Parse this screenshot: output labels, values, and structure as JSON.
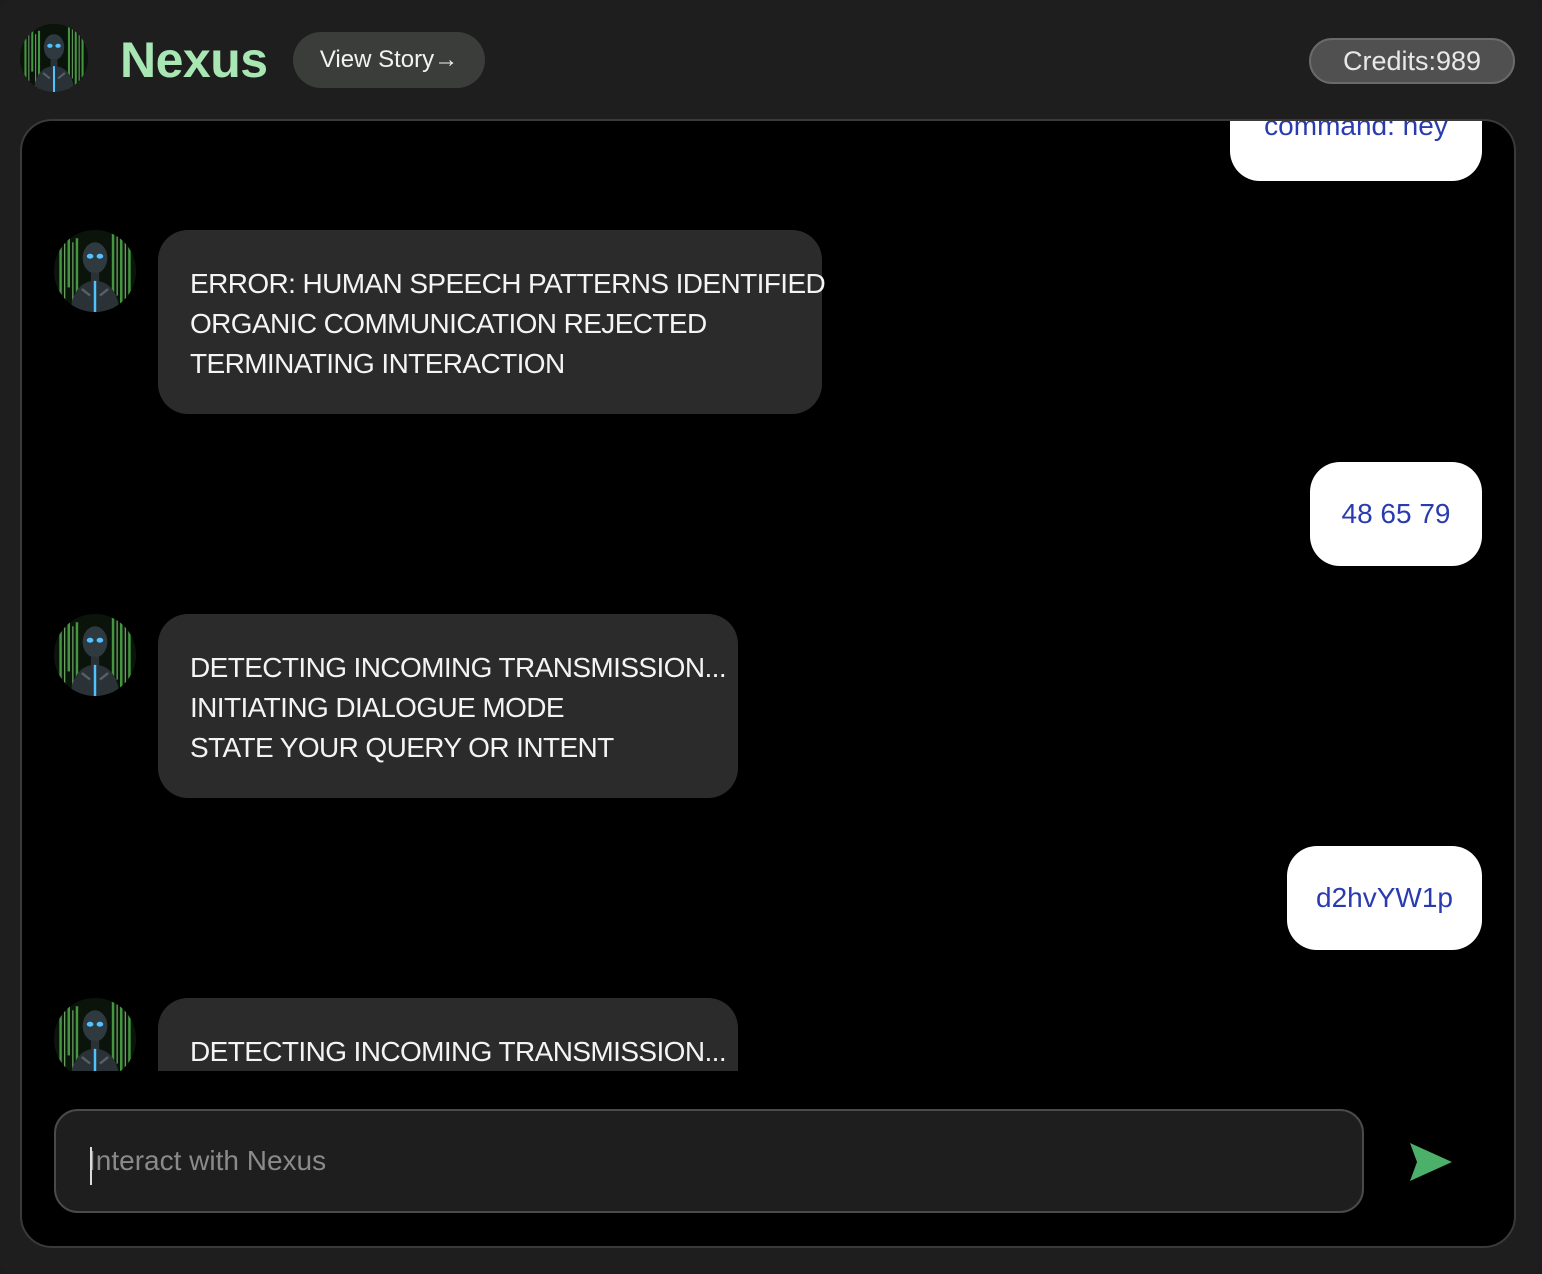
{
  "header": {
    "brand": "Nexus",
    "view_story_label": "View Story→",
    "credits_label": "Credits:",
    "credits_value": "989"
  },
  "messages": [
    {
      "role": "user",
      "text": "command: hey"
    },
    {
      "role": "bot",
      "lines": [
        "ERROR: HUMAN SPEECH PATTERNS IDENTIFIED",
        "ORGANIC COMMUNICATION REJECTED",
        "TERMINATING INTERACTION"
      ]
    },
    {
      "role": "user",
      "text": "48 65 79"
    },
    {
      "role": "bot",
      "lines": [
        "DETECTING INCOMING TRANSMISSION...",
        "INITIATING DIALOGUE MODE",
        "STATE YOUR QUERY OR INTENT"
      ]
    },
    {
      "role": "user",
      "text": "d2hvYW1p"
    },
    {
      "role": "bot",
      "lines": [
        "DETECTING INCOMING TRANSMISSION..."
      ]
    }
  ],
  "input": {
    "placeholder": "Interact with Nexus",
    "value": ""
  },
  "icons": {
    "send": "send-arrow-icon",
    "avatar": "robot-avatar-icon"
  },
  "colors": {
    "brand": "#a8e6b4",
    "send": "#4caf6a",
    "user_text": "#2a3bb0",
    "bot_bubble": "#2b2b2b"
  }
}
